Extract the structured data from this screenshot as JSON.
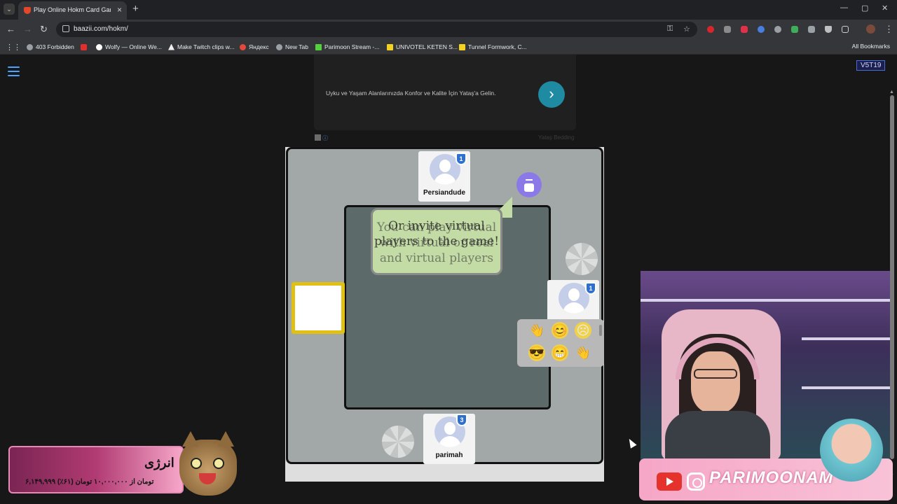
{
  "browser": {
    "tab_title": "Play Online Hokm Card Game",
    "url": "baazii.com/hokm/",
    "bookmarks": [
      "403 Forbidden",
      "Wolfy — Online We...",
      "Make Twitch clips w...",
      "Яндекс",
      "New Tab",
      "Parimoon Stream -...",
      "UNIVOTEL KETEN S...",
      "Tunnel Formwork, C..."
    ],
    "all_bookmarks": "All Bookmarks"
  },
  "page": {
    "version_badge": "V5T19",
    "ad": {
      "text": "Uyku ve Yaşam Alanlarınızda Konfor ve Kalite İçin Yataş'a Gelin.",
      "brand": "Yataş Bedding"
    }
  },
  "game": {
    "players": {
      "top": {
        "name": "Persiandude",
        "level": "1"
      },
      "right": {
        "name": "",
        "level": "1"
      },
      "bottom": {
        "name": "parimah",
        "level": "3"
      }
    },
    "bubble_text_a": "You can play virtual with virtual or real and virtual players",
    "bubble_text_b": "Or invite virtual players to the game!",
    "emojis": [
      "👋",
      "😊",
      "☹",
      "😎",
      "😁",
      "👋"
    ]
  },
  "stream": {
    "energy_title": "انرژی",
    "energy_subtitle": "۶,۱۴۹,۹۹۹ تومان از ۱۰,۰۰۰,۰۰۰ تومان (۶۱٪)",
    "energy_progress": 0.61,
    "social_handle": "PARIMOONAM"
  }
}
